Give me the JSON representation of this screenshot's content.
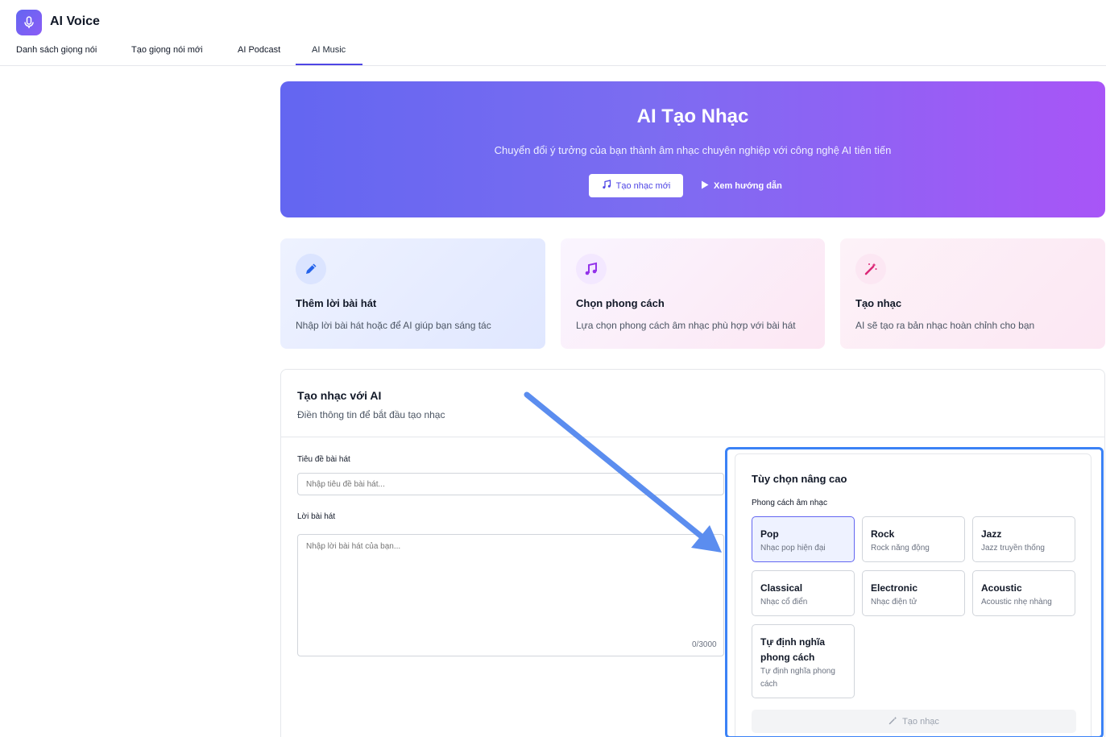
{
  "app": {
    "title": "AI Voice"
  },
  "tabs": [
    {
      "label": "Danh sách giọng nói"
    },
    {
      "label": "Tạo giọng nói mới"
    },
    {
      "label": "AI Podcast"
    },
    {
      "label": "AI Music",
      "active": true
    }
  ],
  "hero": {
    "title": "AI Tạo Nhạc",
    "subtitle": "Chuyển đổi ý tưởng của bạn thành âm nhạc chuyên nghiệp với công nghệ AI tiên tiến",
    "primary_button": "Tạo nhạc mới",
    "secondary_button": "Xem hướng dẫn"
  },
  "features": [
    {
      "title": "Thêm lời bài hát",
      "desc": "Nhập lời bài hát hoặc để AI giúp bạn sáng tác",
      "icon": "pencil-icon"
    },
    {
      "title": "Chọn phong cách",
      "desc": "Lựa chọn phong cách âm nhạc phù hợp với bài hát",
      "icon": "music-note-icon"
    },
    {
      "title": "Tạo nhạc",
      "desc": "AI sẽ tạo ra bản nhạc hoàn chỉnh cho bạn",
      "icon": "magic-wand-icon"
    }
  ],
  "form": {
    "title": "Tạo nhạc với AI",
    "subtitle": "Điền thông tin để bắt đầu tạo nhạc",
    "song_title_label": "Tiêu đề bài hát",
    "song_title_placeholder": "Nhập tiêu đề bài hát...",
    "lyrics_label": "Lời bài hát",
    "lyrics_placeholder": "Nhập lời bài hát của bạn...",
    "char_count": "0/3000"
  },
  "advanced": {
    "title": "Tùy chọn nâng cao",
    "style_label": "Phong cách âm nhạc",
    "styles": [
      {
        "name": "Pop",
        "desc": "Nhạc pop hiện đại",
        "selected": true
      },
      {
        "name": "Rock",
        "desc": "Rock năng động"
      },
      {
        "name": "Jazz",
        "desc": "Jazz truyền thống"
      },
      {
        "name": "Classical",
        "desc": "Nhạc cổ điển"
      },
      {
        "name": "Electronic",
        "desc": "Nhạc điện tử"
      },
      {
        "name": "Acoustic",
        "desc": "Acoustic nhẹ nhàng"
      },
      {
        "name": "Tự định nghĩa phong cách",
        "desc": "Tự định nghĩa phong cách"
      }
    ],
    "create_button": "Tạo nhạc"
  },
  "colors": {
    "accent": "#4f46e5",
    "hero_start": "#6366f1",
    "hero_end": "#a855f7",
    "annotation": "#3b82f6"
  }
}
